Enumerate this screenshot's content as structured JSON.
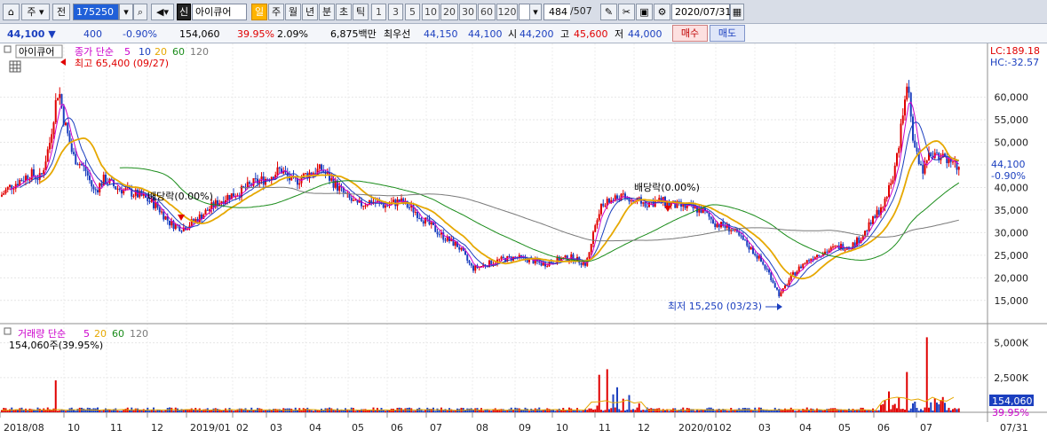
{
  "toolbar": {
    "period_label": "주",
    "jeon_label": "전",
    "code_value": "175250",
    "market_badge": "신",
    "name_value": "아이큐어",
    "timeframes": [
      "일",
      "주",
      "월",
      "년",
      "분",
      "초",
      "틱"
    ],
    "selected_timeframe": "일",
    "intervals": [
      "1",
      "3",
      "5",
      "10",
      "20",
      "30",
      "60",
      "120"
    ],
    "count_current": "484",
    "count_total": "/507",
    "date_value": "2020/07/31"
  },
  "quote": {
    "price": "44,100",
    "change": "400",
    "change_pct": "-0.90%",
    "volume": "154,060",
    "vol_ratio": "39.95%",
    "turnover_pct": "2.09%",
    "amount": "6,875백만",
    "best_label": "최우선",
    "ask": "44,150",
    "bid": "44,100",
    "open_label": "시",
    "open": "44,200",
    "high_label": "고",
    "high": "45,600",
    "low_label": "저",
    "low": "44,000",
    "buy_label": "매수",
    "sell_label": "매도"
  },
  "price_panel": {
    "name_tag": "아이큐어",
    "legend_prefix": "종가 단순",
    "legend_periods": [
      "5",
      "10",
      "20",
      "60",
      "120"
    ],
    "hi_note": "최고 65,400 (09/27)",
    "lo_note": "최저 15,250 (03/23)",
    "div_note_1": "배당락(0.00%)",
    "div_note_2": "배당락(0.00%)",
    "lc": "LC:189.18",
    "hc": "HC:-32.57",
    "last_price": "44,100",
    "last_change": "-0.90%",
    "y_ticks": [
      "60,000",
      "55,000",
      "50,000",
      "45,000",
      "40,000",
      "35,000",
      "30,000",
      "25,000",
      "20,000",
      "15,000"
    ]
  },
  "volume_panel": {
    "legend_prefix": "거래량 단순",
    "legend_periods": [
      "5",
      "20",
      "60",
      "120"
    ],
    "value_note": "154,060주(39.95%)",
    "y_ticks": [
      "5,000K",
      "2,500K"
    ],
    "last_volume": "154,060",
    "last_ratio": "39.95%"
  },
  "x_axis": {
    "labels": [
      "2018/08",
      "10",
      "11",
      "12",
      "2019/01",
      "02",
      "03",
      "04",
      "05",
      "06",
      "07",
      "08",
      "09",
      "10",
      "11",
      "12",
      "2020/01",
      "02",
      "03",
      "04",
      "05",
      "06",
      "07"
    ],
    "right_label": "07/31"
  },
  "colors": {
    "up": "#e00000",
    "down": "#1b3fbf",
    "ma5": "#cc00cc",
    "ma10": "#1b3fbf",
    "ma20": "#e6a800",
    "ma60": "#1a8c1a",
    "ma120": "#7a7a7a"
  },
  "chart_data": {
    "type": "candlestick",
    "x_dates": [
      "2018/08",
      "2018/10",
      "2018/11",
      "2018/12",
      "2019/01",
      "2019/02",
      "2019/03",
      "2019/04",
      "2019/05",
      "2019/06",
      "2019/07",
      "2019/08",
      "2019/09",
      "2019/10",
      "2019/11",
      "2019/12",
      "2020/01",
      "2020/02",
      "2020/03",
      "2020/04",
      "2020/05",
      "2020/06",
      "2020/07"
    ],
    "close_path": [
      [
        0,
        38000
      ],
      [
        10,
        40000
      ],
      [
        22,
        41500
      ],
      [
        34,
        43000
      ],
      [
        46,
        42000
      ],
      [
        56,
        50000
      ],
      [
        62,
        58000
      ],
      [
        66,
        62000
      ],
      [
        72,
        55000
      ],
      [
        82,
        47000
      ],
      [
        96,
        44000
      ],
      [
        106,
        39000
      ],
      [
        118,
        42000
      ],
      [
        130,
        40000
      ],
      [
        146,
        39000
      ],
      [
        160,
        38000
      ],
      [
        176,
        36000
      ],
      [
        192,
        32000
      ],
      [
        206,
        31000
      ],
      [
        222,
        33000
      ],
      [
        240,
        36000
      ],
      [
        256,
        38000
      ],
      [
        270,
        39000
      ],
      [
        286,
        41000
      ],
      [
        300,
        42000
      ],
      [
        316,
        44000
      ],
      [
        330,
        41000
      ],
      [
        346,
        43000
      ],
      [
        362,
        44000
      ],
      [
        376,
        41000
      ],
      [
        390,
        38000
      ],
      [
        402,
        36000
      ],
      [
        418,
        37000
      ],
      [
        434,
        36000
      ],
      [
        450,
        37000
      ],
      [
        466,
        35000
      ],
      [
        482,
        32000
      ],
      [
        500,
        29000
      ],
      [
        516,
        27000
      ],
      [
        532,
        22000
      ],
      [
        548,
        23000
      ],
      [
        564,
        24000
      ],
      [
        580,
        24500
      ],
      [
        596,
        24000
      ],
      [
        612,
        23000
      ],
      [
        628,
        24000
      ],
      [
        644,
        24500
      ],
      [
        660,
        23000
      ],
      [
        674,
        35000
      ],
      [
        686,
        37000
      ],
      [
        698,
        38000
      ],
      [
        712,
        37000
      ],
      [
        728,
        36500
      ],
      [
        744,
        37000
      ],
      [
        760,
        36000
      ],
      [
        776,
        35500
      ],
      [
        790,
        35000
      ],
      [
        806,
        32000
      ],
      [
        822,
        31000
      ],
      [
        838,
        28000
      ],
      [
        852,
        25000
      ],
      [
        866,
        21000
      ],
      [
        878,
        16000
      ],
      [
        890,
        20000
      ],
      [
        904,
        23000
      ],
      [
        918,
        25000
      ],
      [
        932,
        26000
      ],
      [
        946,
        27000
      ],
      [
        958,
        27000
      ],
      [
        970,
        29000
      ],
      [
        984,
        33000
      ],
      [
        998,
        38000
      ],
      [
        1008,
        44000
      ],
      [
        1016,
        55000
      ],
      [
        1022,
        62000
      ],
      [
        1030,
        48000
      ],
      [
        1040,
        44000
      ],
      [
        1050,
        48000
      ],
      [
        1060,
        47000
      ],
      [
        1072,
        46000
      ],
      [
        1080,
        44100
      ]
    ],
    "ma_periods": [
      "5",
      "10",
      "20",
      "60",
      "120"
    ],
    "annotations": [
      "최고 65,400 (09/27)",
      "최저 15,250 (03/23)",
      "배당락(0.00%)",
      "배당락(0.00%)"
    ],
    "ylim": [
      13000,
      66000
    ],
    "volume_ylim": [
      0,
      6000000
    ]
  }
}
